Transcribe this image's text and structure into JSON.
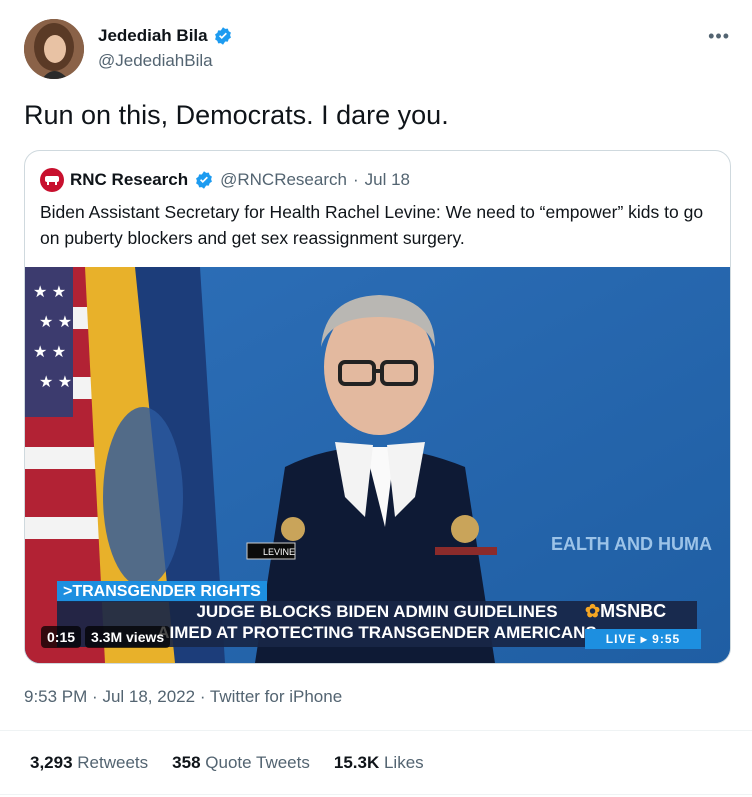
{
  "author": {
    "name": "Jedediah Bila",
    "handle": "@JedediahBila",
    "avatar_alt": "avatar"
  },
  "tweet": {
    "text": "Run on this, Democrats. I dare you.",
    "time": "9:53 PM",
    "date": "Jul 18, 2022",
    "source": "Twitter for iPhone"
  },
  "quoted": {
    "name": "RNC Research",
    "handle": "@RNCResearch",
    "date": "Jul 18",
    "text": "Biden Assistant Secretary for Health Rachel Levine: We need to “empower” kids to go on puberty blockers and get sex reassignment surgery.",
    "video": {
      "duration": "0:15",
      "views": "3.3M views",
      "chyron_tag": ">TRANSGENDER RIGHTS",
      "chyron_line1": "JUDGE BLOCKS BIDEN ADMIN GUIDELINES",
      "chyron_line2": "AIMED AT PROTECTING TRANSGENDER AMERICANS",
      "network": "MSNBC",
      "live": "LIVE  ▸  9:55",
      "wall_text": "EALTH AND HUMA",
      "name_tag": "LEVINE"
    }
  },
  "stats": [
    {
      "count": "3,293",
      "label": "Retweets"
    },
    {
      "count": "358",
      "label": "Quote Tweets"
    },
    {
      "count": "15.3K",
      "label": "Likes"
    }
  ],
  "colors": {
    "verified": "#1d9bf0",
    "secondary_text": "#536471",
    "border": "#cfd9de"
  }
}
